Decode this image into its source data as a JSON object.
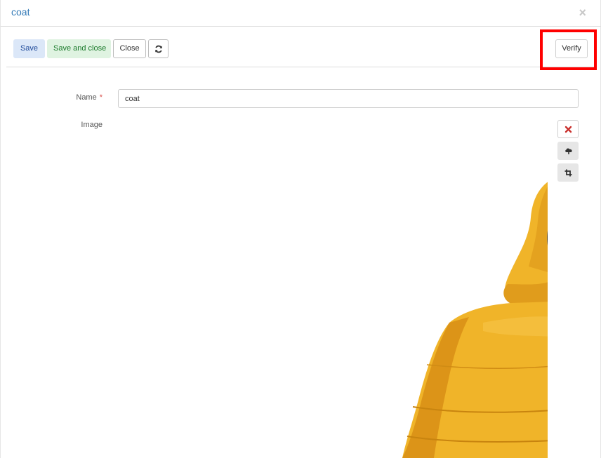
{
  "header": {
    "title": "coat",
    "close_symbol": "×"
  },
  "toolbar": {
    "save_label": "Save",
    "save_close_label": "Save and close",
    "close_label": "Close",
    "refresh_icon": "refresh-icon",
    "verify_label": "Verify"
  },
  "form": {
    "name_label": "Name",
    "required_mark": "*",
    "name_value": "coat",
    "image_label": "Image"
  },
  "image_controls": {
    "remove_icon": "remove-icon",
    "upload_icon": "cloud-upload-icon",
    "crop_icon": "crop-icon"
  },
  "colors": {
    "title": "#337ab7",
    "save_bg": "#dbe7f8",
    "save_close_bg": "#dff3e1",
    "highlight": "#ff0000",
    "coat": "#f0b429"
  }
}
